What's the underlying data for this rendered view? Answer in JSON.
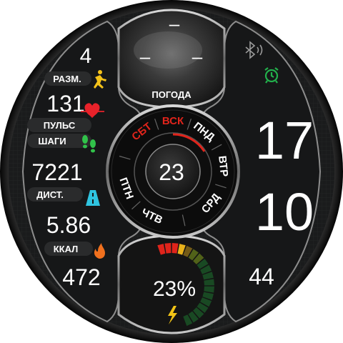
{
  "left_panel": {
    "steps_goal_multiplier": "4",
    "razm_label": "РАЗМ.",
    "pulse_value": "131",
    "pulse_label": "ПУЛЬС",
    "steps_label": "ШАГИ",
    "steps_value": "7221",
    "distance_label": "ДИСТ.",
    "distance_value": "5.86",
    "kcal_label": "ККАЛ",
    "kcal_value": "472"
  },
  "weather": {
    "top_value": "–",
    "left_value": "–",
    "right_value": "–",
    "label": "ПОГОДА"
  },
  "day_ring": {
    "days": [
      "СБТ",
      "ВСК",
      "ПНД",
      "ВТР",
      "СРД",
      "ЧТВ",
      "ПТН"
    ],
    "highlighted_days": [
      "СБТ",
      "ВСК"
    ],
    "date": "23"
  },
  "battery": {
    "percent_text": "23%",
    "level": 0.23
  },
  "right_panel": {
    "hours": "17",
    "minutes": "10",
    "seconds": "44"
  },
  "colors": {
    "accent_red": "#e0241b",
    "accent_green": "#22b14c",
    "heart_red": "#e8222a",
    "steps_green": "#31c24a",
    "road_cyan": "#2fc4e0",
    "flame_orange": "#f0701e",
    "bolt_yellow": "#f2c316",
    "runner_yellow": "#f4c21a"
  },
  "icons": [
    "runner-icon",
    "heart-pulse-icon",
    "footsteps-icon",
    "road-icon",
    "flame-icon",
    "bluetooth-icon",
    "alarm-clock-icon",
    "lightning-icon"
  ]
}
